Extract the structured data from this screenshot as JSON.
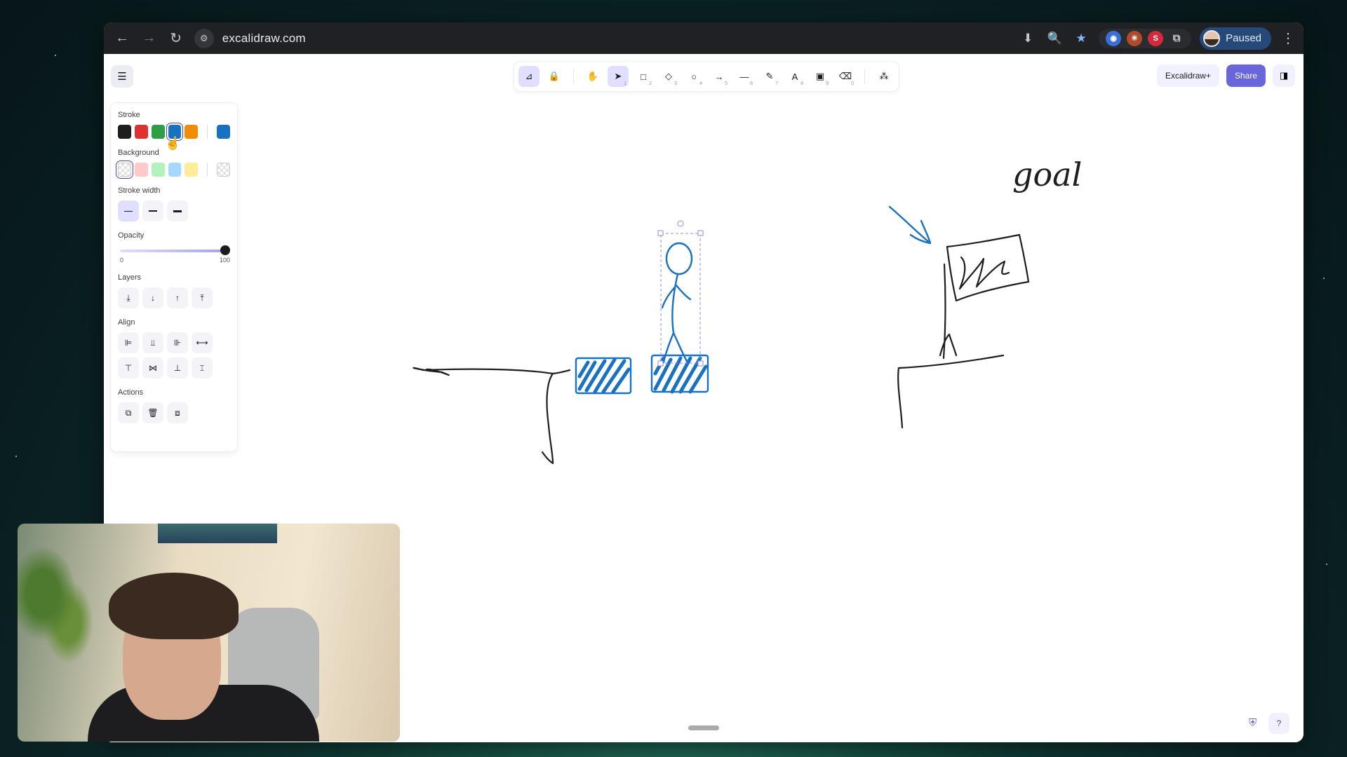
{
  "browser": {
    "url": "excalidraw.com",
    "profile_label": "Paused",
    "nav": {
      "back": "←",
      "forward": "→",
      "reload": "↻"
    }
  },
  "toolbar": {
    "tools": [
      {
        "name": "hand-lock-tool",
        "glyph": "🔒",
        "key": ""
      },
      {
        "name": "hand-tool",
        "glyph": "✋",
        "key": ""
      },
      {
        "name": "selection-tool",
        "glyph": "➤",
        "key": "1"
      },
      {
        "name": "rectangle-tool",
        "glyph": "□",
        "key": "2"
      },
      {
        "name": "diamond-tool",
        "glyph": "◇",
        "key": "3"
      },
      {
        "name": "ellipse-tool",
        "glyph": "○",
        "key": "4"
      },
      {
        "name": "arrow-tool",
        "glyph": "→",
        "key": "5"
      },
      {
        "name": "line-tool",
        "glyph": "—",
        "key": "6"
      },
      {
        "name": "draw-tool",
        "glyph": "✎",
        "key": "7"
      },
      {
        "name": "text-tool",
        "glyph": "A",
        "key": "8"
      },
      {
        "name": "image-tool",
        "glyph": "▣",
        "key": "9"
      },
      {
        "name": "eraser-tool",
        "glyph": "⌫",
        "key": "0"
      }
    ],
    "extra_glyph": "⁂",
    "active_tool": "selection-tool"
  },
  "top_right": {
    "plus_label": "Excalidraw+",
    "share_label": "Share"
  },
  "props": {
    "stroke_label": "Stroke",
    "stroke_colors": [
      "#1e1e1e",
      "#e03131",
      "#2f9e44",
      "#1971c2",
      "#f08c00"
    ],
    "stroke_current": "#1971c2",
    "background_label": "Background",
    "background_colors": [
      "transparent",
      "#ffc9c9",
      "#b2f2bb",
      "#a5d8ff",
      "#ffec99"
    ],
    "background_current": "transparent",
    "stroke_width_label": "Stroke width",
    "opacity_label": "Opacity",
    "opacity_min": "0",
    "opacity_max": "100",
    "opacity_value": 100,
    "layers_label": "Layers",
    "layers": [
      "⤓",
      "↓",
      "↑",
      "⤒"
    ],
    "align_label": "Align",
    "align_row1": [
      "⊫",
      "⫫",
      "⊪",
      "⟷"
    ],
    "align_row2": [
      "⊤",
      "⋈",
      "⊥",
      "⌶"
    ],
    "actions_label": "Actions",
    "actions": [
      "⧉",
      "🗑",
      "⧈"
    ]
  },
  "canvas": {
    "goal_text": "goal",
    "stroke_blue": "#1971c2",
    "stroke_black": "#1e1e1e"
  }
}
